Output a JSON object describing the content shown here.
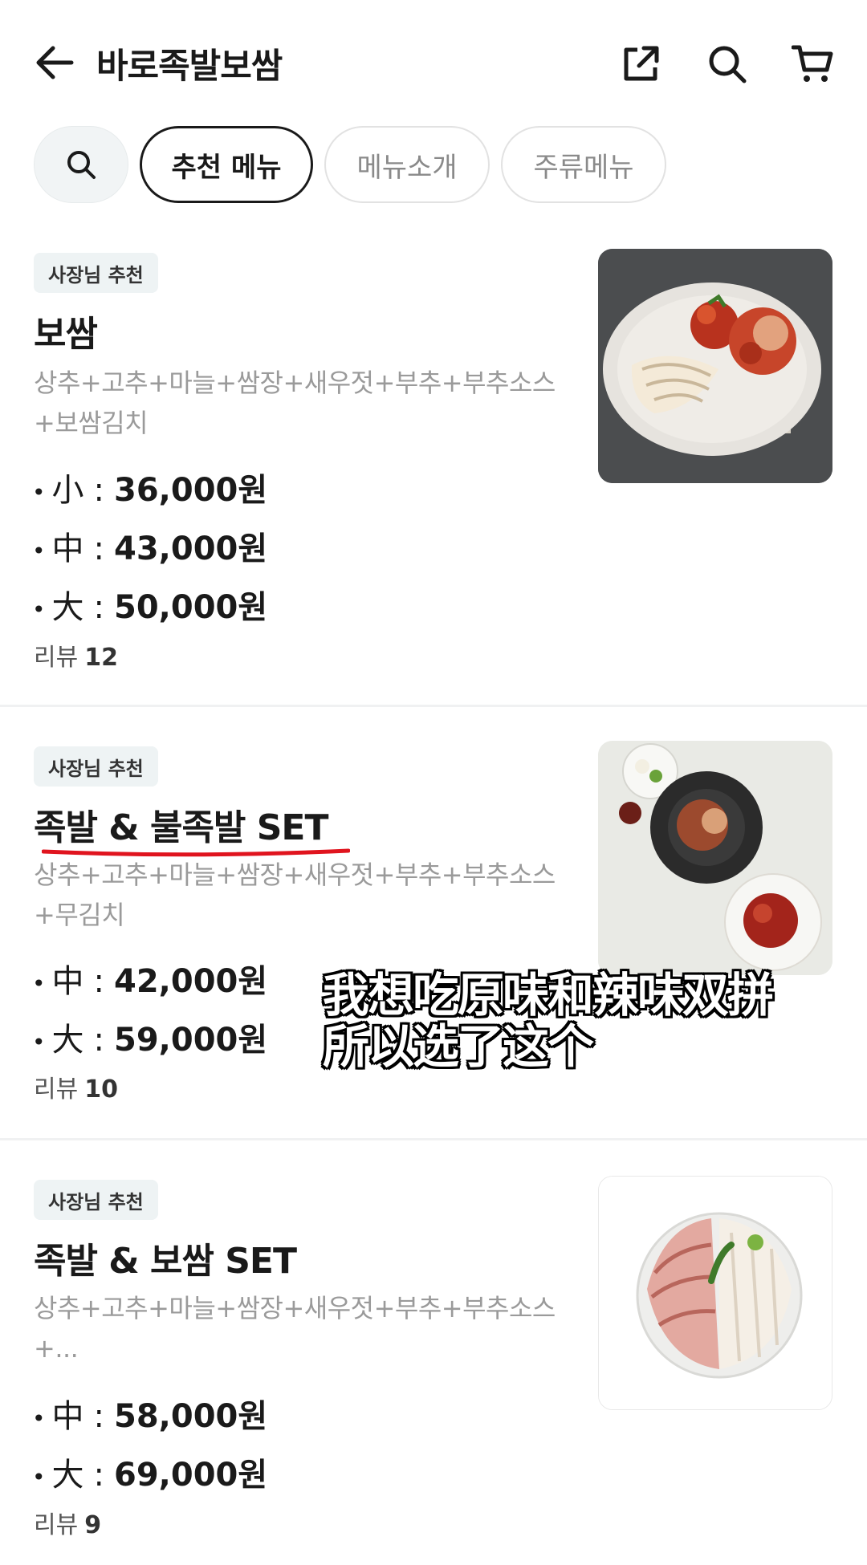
{
  "header": {
    "title": "바로족발보쌈",
    "icons": [
      "back-arrow-icon",
      "share-icon",
      "search-icon",
      "cart-icon"
    ]
  },
  "tabs": [
    {
      "label": "추천 메뉴",
      "active": true
    },
    {
      "label": "메뉴소개",
      "active": false
    },
    {
      "label": "주류메뉴",
      "active": false
    }
  ],
  "menu": [
    {
      "badge": "사장님 추천",
      "name": "보쌈",
      "desc_lines": [
        "상추+고추+마늘+쌈장+새우젓+부추+부추소스",
        "+보쌈김치"
      ],
      "prices": [
        {
          "size": "小",
          "amount": "36,000원"
        },
        {
          "size": "中",
          "amount": "43,000원"
        },
        {
          "size": "大",
          "amount": "50,000원"
        }
      ],
      "review_label": "리뷰",
      "review_count": "12"
    },
    {
      "badge": "사장님 추천",
      "name": "족발 & 불족발 SET",
      "desc_lines": [
        "상추+고추+마늘+쌈장+새우젓+부추+부추소스",
        "+무김치"
      ],
      "prices": [
        {
          "size": "中",
          "amount": "42,000원"
        },
        {
          "size": "大",
          "amount": "59,000원"
        }
      ],
      "review_label": "리뷰",
      "review_count": "10"
    },
    {
      "badge": "사장님 추천",
      "name": "족발 & 보쌈 SET",
      "desc_lines": [
        "상추+고추+마늘+쌈장+새우젓+부추+부추소스",
        "+..."
      ],
      "prices": [
        {
          "size": "中",
          "amount": "58,000원"
        },
        {
          "size": "大",
          "amount": "69,000원"
        }
      ],
      "review_label": "리뷰",
      "review_count": "9"
    }
  ],
  "subtitle": {
    "line1": "我想吃原味和辣味双拼",
    "line2": "所以选了这个"
  },
  "colors": {
    "underline": "#e0141e",
    "badge_bg": "#eef3f4",
    "desc_text": "#9a9a9a"
  }
}
